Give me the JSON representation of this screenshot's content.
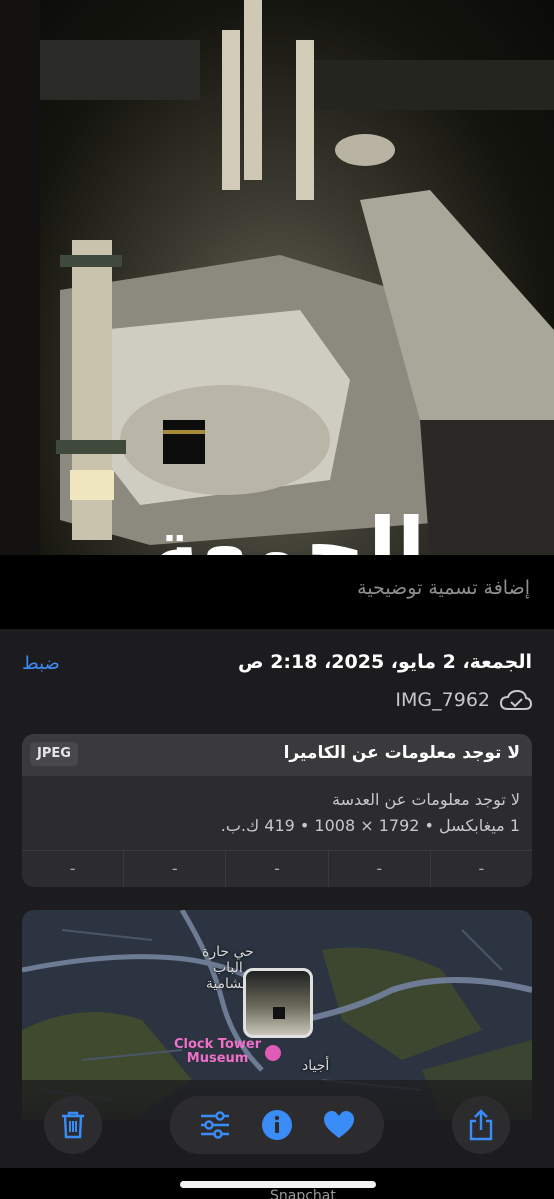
{
  "photo": {
    "overlay_caption": "الجمعة"
  },
  "caption": {
    "placeholder": "إضافة تسمية توضيحية"
  },
  "info": {
    "adjust_label": "ضبط",
    "datetime": "الجمعة، 2 مايو، 2025، 2:18 ص",
    "filename": "IMG_7962",
    "format_badge": "JPEG",
    "camera_info": "لا توجد معلومات عن الكاميرا",
    "lens_info": "لا توجد معلومات عن العدسة",
    "specs": "1 ميغابكسل • 1792 × 1008 • 419 ك.ب.",
    "exif_cells": [
      "-",
      "-",
      "-",
      "-",
      "-"
    ]
  },
  "map": {
    "district_label": "حي حارة الباب الشامية",
    "district_line1": "حي حارة",
    "district_line2": "الباب",
    "district_line3": "الشامية",
    "museum_line1": "Clock Tower",
    "museum_line2": "Museum",
    "ajyad_label": "أجياد"
  },
  "toolbar": {
    "delete_icon": "trash-icon",
    "adjust_icon": "sliders-icon",
    "info_icon": "info-icon",
    "favorite_icon": "heart-icon",
    "share_icon": "share-icon"
  },
  "bottom_peek": "Snapchat",
  "colors": {
    "accent": "#3a8cf6",
    "sheet_bg": "#1c1c1e",
    "card_bg": "#2c2c2e",
    "museum_pink": "#e05bb6"
  }
}
